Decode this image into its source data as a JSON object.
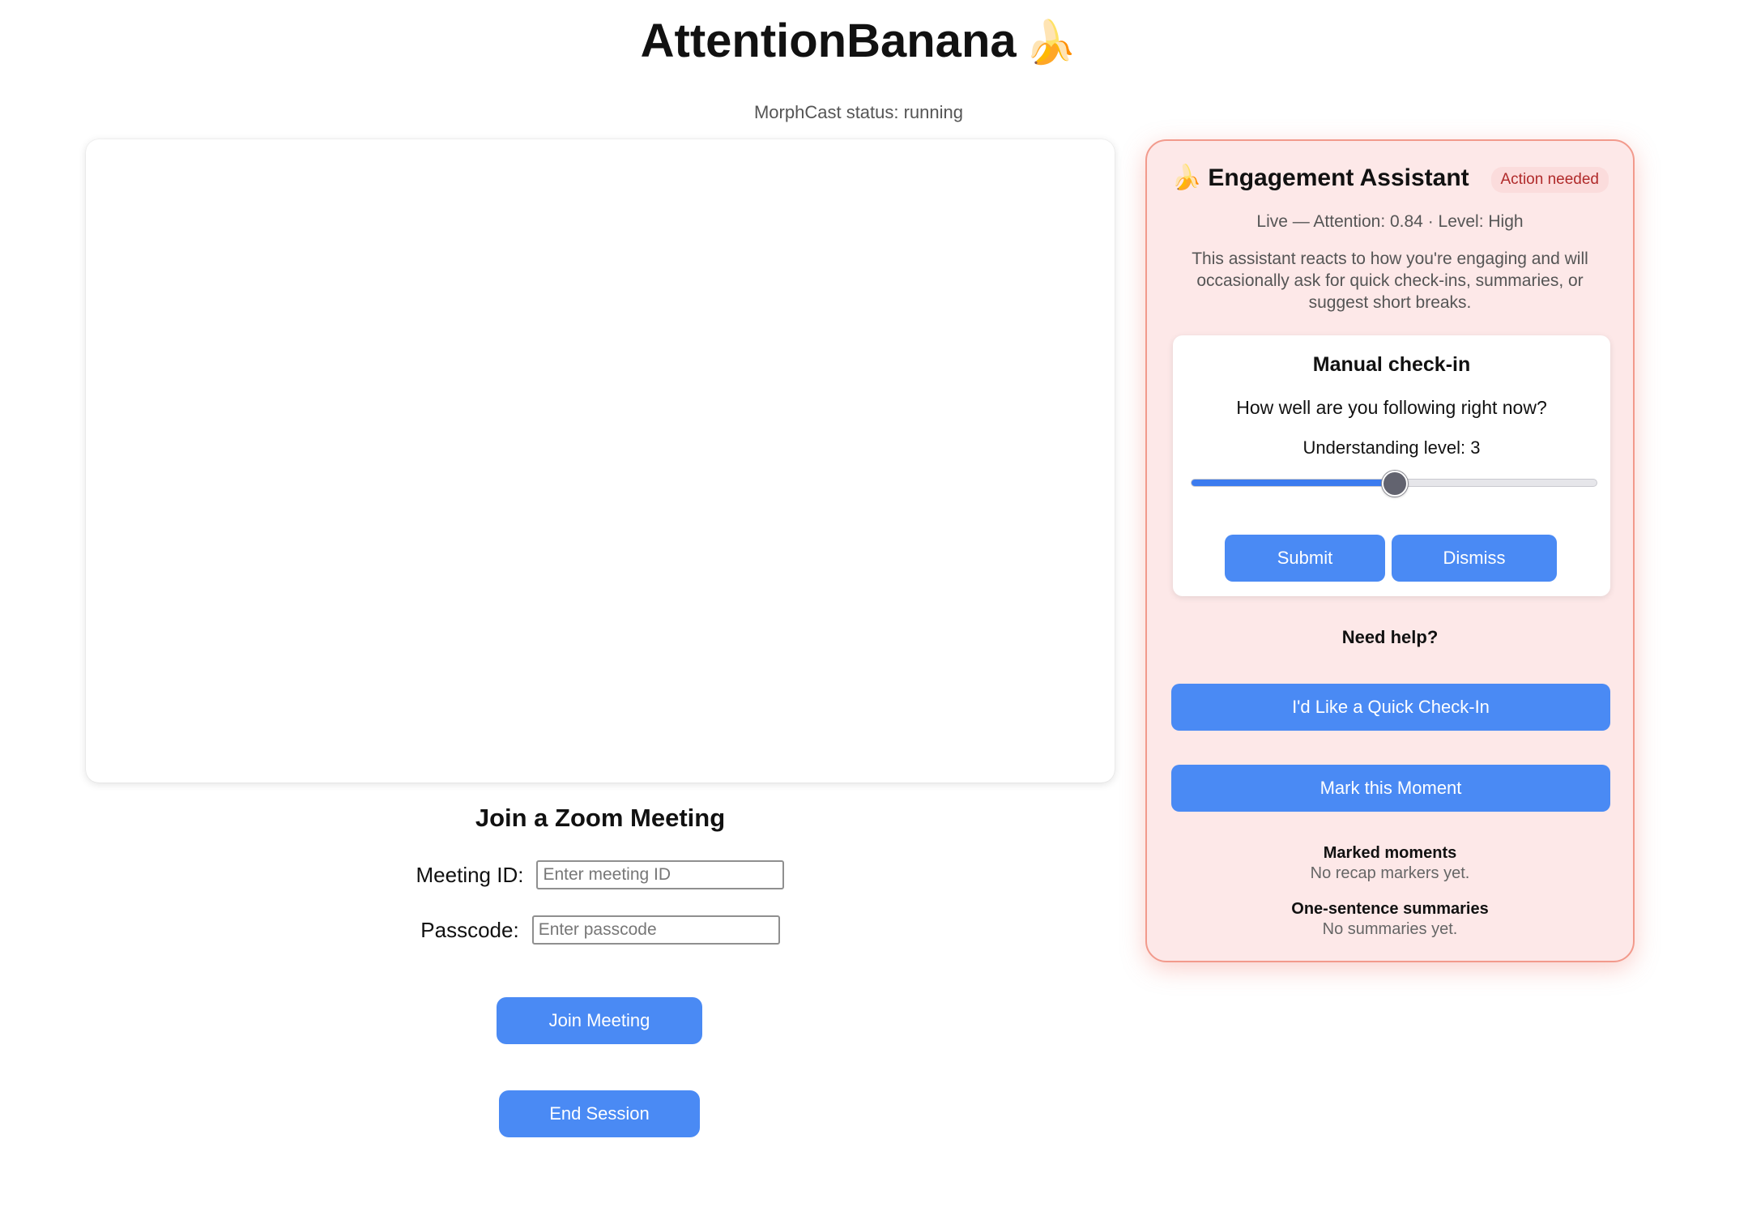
{
  "header": {
    "title": "AttentionBanana",
    "title_emoji": "🍌",
    "morphcast_status": "MorphCast status: running"
  },
  "join": {
    "title": "Join a Zoom Meeting",
    "meeting_id_label": "Meeting ID:",
    "meeting_id_placeholder": "Enter meeting ID",
    "meeting_id_value": "",
    "passcode_label": "Passcode:",
    "passcode_placeholder": "Enter passcode",
    "passcode_value": "",
    "join_button": "Join Meeting",
    "end_button": "End Session"
  },
  "assistant": {
    "emoji": "🍌",
    "title": "Engagement Assistant",
    "badge": "Action needed",
    "live_status": "Live — Attention: 0.84 · Level: High",
    "description": "This assistant reacts to how you're engaging and will occasionally ask for quick check-ins, summaries, or suggest short breaks.",
    "checkin": {
      "title": "Manual check-in",
      "question": "How well are you following right now?",
      "understanding_label": "Understanding level: 3",
      "slider": {
        "min": 1,
        "max": 5,
        "value": 3
      },
      "submit": "Submit",
      "dismiss": "Dismiss"
    },
    "need_help": "Need help?",
    "quick_checkin_button": "I'd Like a Quick Check-In",
    "mark_moment_button": "Mark this Moment",
    "marked_moments_title": "Marked moments",
    "marked_moments_empty": "No recap markers yet.",
    "summaries_title": "One-sentence summaries",
    "summaries_empty": "No summaries yet."
  },
  "colors": {
    "primary_button": "#4a8af4",
    "assistant_bg": "#fde8e8",
    "assistant_border": "#f29a8c",
    "badge_text": "#b02a2a",
    "slider_fill": "#3b7bef"
  }
}
